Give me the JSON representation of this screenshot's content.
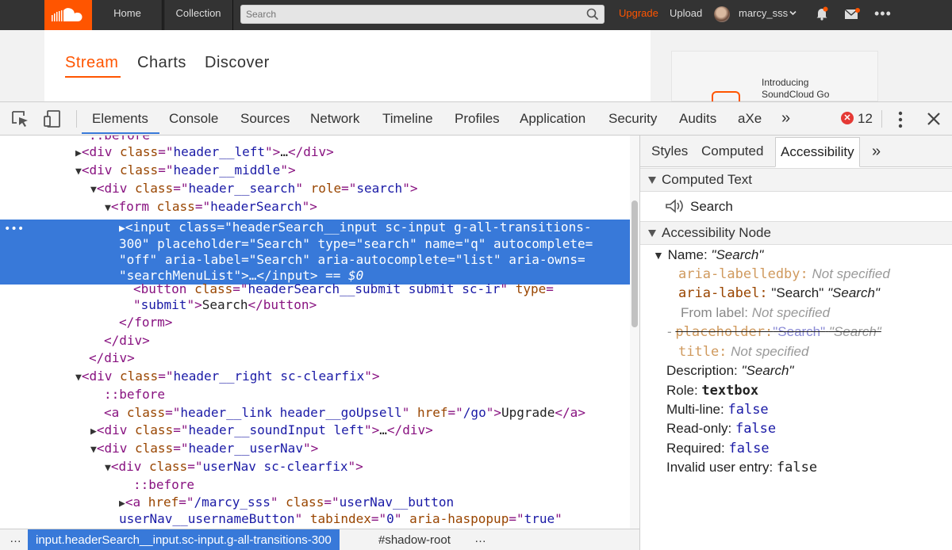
{
  "soundcloud": {
    "nav": {
      "home": "Home",
      "collection": "Collection"
    },
    "search": {
      "placeholder": "Search"
    },
    "upgrade": "Upgrade",
    "upload": "Upload",
    "username": "marcy_sss",
    "more": "•••",
    "tabs": {
      "stream": "Stream",
      "charts": "Charts",
      "discover": "Discover"
    },
    "promo": {
      "line1": "Introducing",
      "line2": "SoundCloud Go"
    },
    "brand_color": "#ff5500"
  },
  "devtools": {
    "tabs": [
      "Elements",
      "Console",
      "Sources",
      "Network",
      "Timeline",
      "Profiles",
      "Application",
      "Security",
      "Audits",
      "aXe"
    ],
    "more_tabs": "»",
    "error_badge": "✕",
    "error_count": "12",
    "dom": {
      "before_top": "::before",
      "header_left": {
        "tag": "div",
        "attr": "class",
        "val": "header__left",
        "ellipsis": "…"
      },
      "header_middle": {
        "tag": "div",
        "attr": "class",
        "val": "header__middle"
      },
      "header_search": {
        "tag": "div",
        "attr": "class",
        "val": "header__search",
        "attr2": "role",
        "val2": "search"
      },
      "form": {
        "tag": "form",
        "attr": "class",
        "val": "headerSearch"
      },
      "input": {
        "tag": "input",
        "l1_attr": "class",
        "l1_val": "headerSearch__input sc-input g-all-transitions-",
        "l2_val": "300",
        "l2_a1": "placeholder",
        "l2_v1": "Search",
        "l2_a2": "type",
        "l2_v2": "search",
        "l2_a3": "name",
        "l2_v3": "q",
        "l2_a4": "autocomplete",
        "l3_v1": "off",
        "l3_a2": "aria-label",
        "l3_v2": "Search",
        "l3_a3": "aria-autocomplete",
        "l3_v3": "list",
        "l3_a4": "aria-owns",
        "l4_v1": "searchMenuList",
        "l4_ellipsis": "…",
        "l4_close": "input",
        "l4_eq": "== $0"
      },
      "button": {
        "tag": "button",
        "a1": "class",
        "v1": "headerSearch__submit submit sc-ir",
        "a2": "type",
        "v2": "submit",
        "text": "Search"
      },
      "close_form": "form",
      "close_div": "div",
      "header_right": {
        "tag": "div",
        "attr": "class",
        "val": "header__right sc-clearfix"
      },
      "before": "::before",
      "link": {
        "tag": "a",
        "a1": "class",
        "v1": "header__link header__goUpsell",
        "a2": "href",
        "v2": "/go",
        "text": "Upgrade"
      },
      "sound_input": {
        "tag": "div",
        "attr": "class",
        "val": "header__soundInput left",
        "ellipsis": "…"
      },
      "user_nav_wrap": {
        "tag": "div",
        "attr": "class",
        "val": "header__userNav"
      },
      "user_nav": {
        "tag": "div",
        "attr": "class",
        "val": "userNav sc-clearfix"
      },
      "user_link": {
        "tag": "a",
        "a1": "href",
        "v1": "/marcy_sss",
        "a2": "class",
        "v2": "userNav__button",
        "l2_v2": "userNav__usernameButton",
        "a3": "tabindex",
        "v3": "0",
        "a4": "aria-haspopup",
        "v4": "true"
      }
    },
    "breadcrumb": {
      "dots": "…",
      "selected": "input.headerSearch__input.sc-input.g-all-transitions-300",
      "shadow": "#shadow-root"
    },
    "sidebar": {
      "tabs": {
        "styles": "Styles",
        "computed": "Computed",
        "accessibility": "Accessibility",
        "more": "»"
      },
      "computed_text": {
        "header": "Computed Text",
        "value": "Search"
      },
      "node": {
        "header": "Accessibility Node",
        "name_label": "Name:",
        "name_value": "\"Search\"",
        "labelledby_attr": "aria-labelledby:",
        "labelledby_value": "Not specified",
        "label_attr": "aria-label:",
        "label_value": "\"Search\"",
        "label_result": "\"Search\"",
        "from_label": "From label:",
        "from_label_value": "Not specified",
        "placeholder_dash": "-",
        "placeholder_attr": "placeholder:",
        "placeholder_value": "\"Search\"",
        "placeholder_result": "\"Search\"",
        "title_attr": "title:",
        "title_value": "Not specified",
        "desc_label": "Description:",
        "desc_value": "\"Search\"",
        "role_label": "Role:",
        "role_value": "textbox",
        "multiline_label": "Multi-line:",
        "multiline_value": "false",
        "readonly_label": "Read-only:",
        "readonly_value": "false",
        "required_label": "Required:",
        "required_value": "false",
        "invalid_label": "Invalid user entry:",
        "invalid_value": "false"
      }
    },
    "accent_color": "#3879d9"
  }
}
